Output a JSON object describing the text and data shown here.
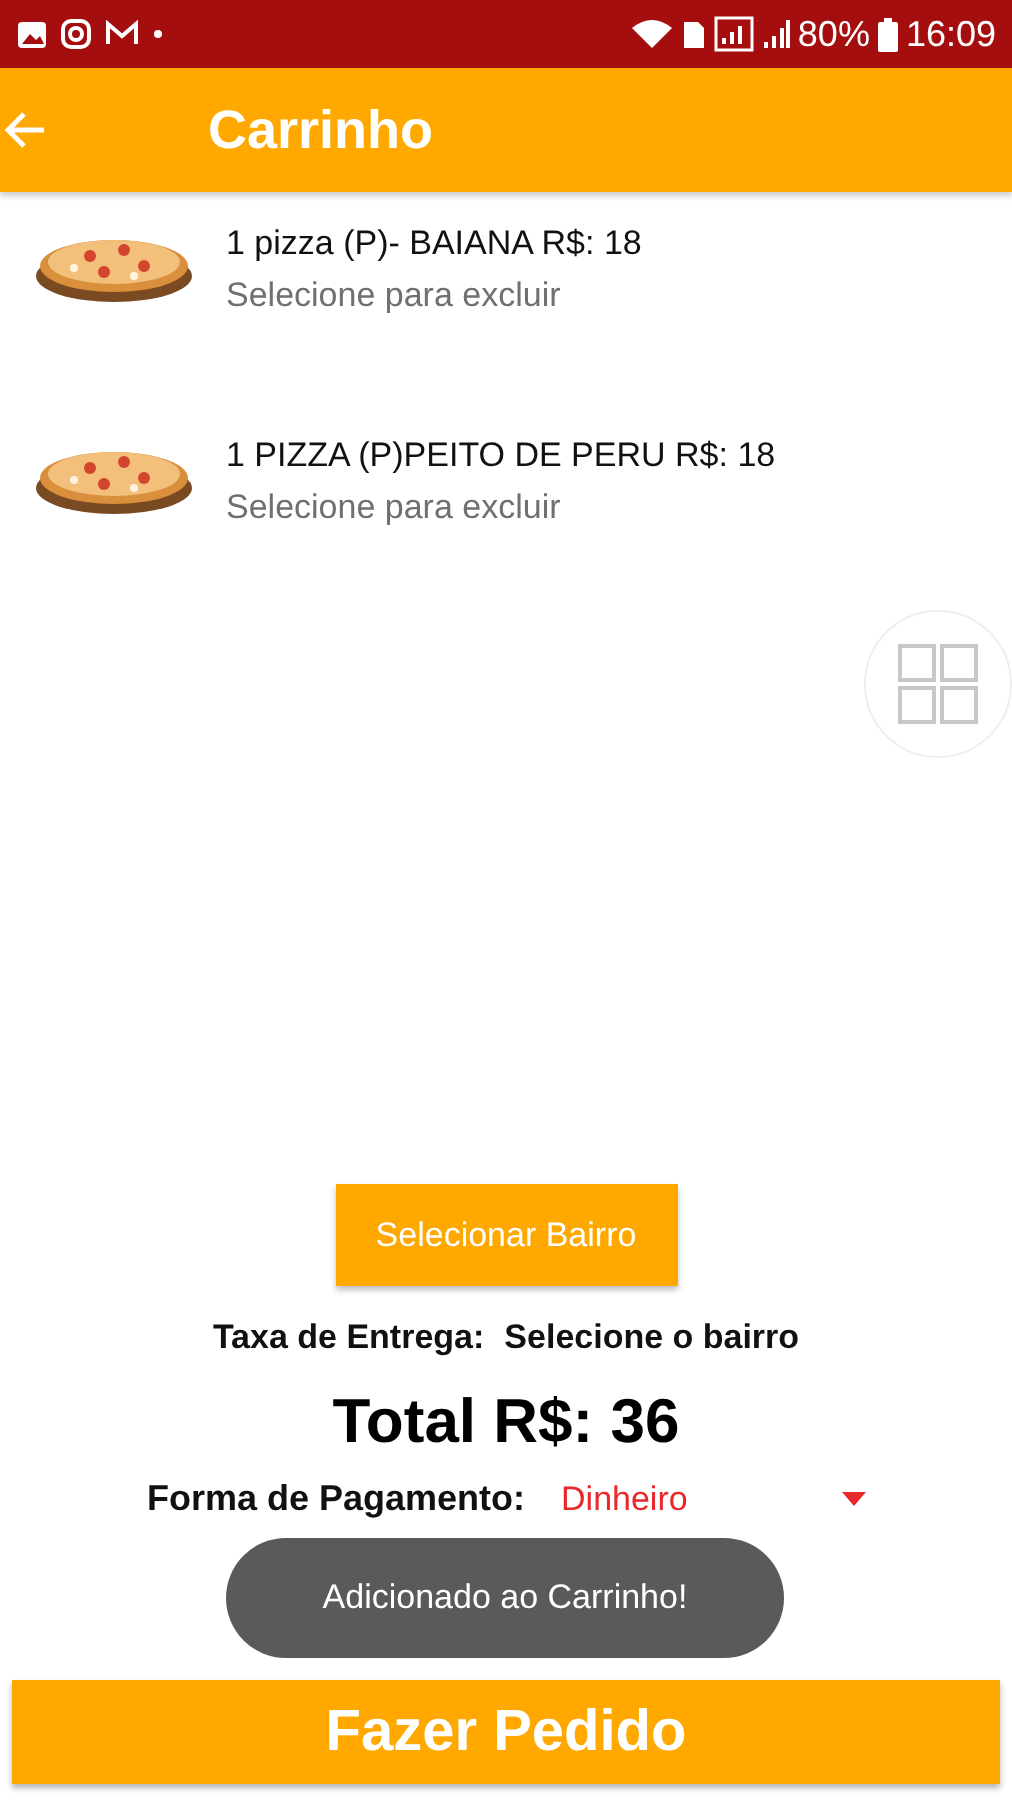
{
  "status_bar": {
    "battery": "80%",
    "time": "16:09"
  },
  "header": {
    "title": "Carrinho"
  },
  "items": [
    {
      "title": "1 pizza (P)- BAIANA R$: 18",
      "subtitle": "Selecione para excluir"
    },
    {
      "title": "1 PIZZA (P)PEITO DE PERU R$: 18",
      "subtitle": "Selecione para excluir"
    }
  ],
  "select_button": "Selecionar Bairro",
  "delivery": {
    "label": "Taxa de Entrega:",
    "value": "Selecione o bairro"
  },
  "total": "Total R$: 36",
  "payment": {
    "label": "Forma de Pagamento:",
    "value": "Dinheiro"
  },
  "toast": "Adicionado ao Carrinho!",
  "order_button": "Fazer Pedido"
}
